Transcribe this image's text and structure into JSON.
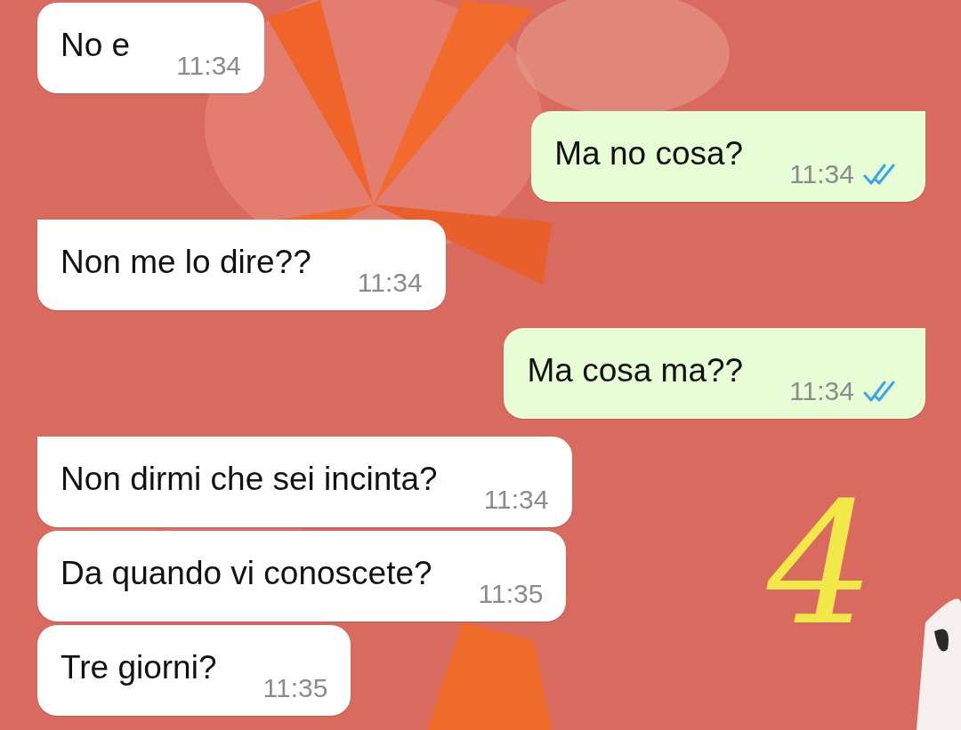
{
  "messages": [
    {
      "kind": "incoming",
      "text": "No e",
      "time": "11:34",
      "tail": false
    },
    {
      "kind": "outgoing",
      "text": "Ma no cosa?",
      "time": "11:34",
      "tail": true,
      "read": true
    },
    {
      "kind": "incoming",
      "text": "Non me lo dire??",
      "time": "11:34",
      "tail": true
    },
    {
      "kind": "outgoing",
      "text": "Ma cosa ma??",
      "time": "11:34",
      "tail": true,
      "read": true
    },
    {
      "kind": "incoming",
      "text": "Non dirmi che sei incinta?",
      "time": "11:34",
      "tail": true
    },
    {
      "kind": "incoming",
      "text": "Da quando vi conoscete?",
      "time": "11:35",
      "tail": false
    },
    {
      "kind": "incoming",
      "text": "Tre giorni?",
      "time": "11:35",
      "tail": false
    }
  ],
  "annotation": "4"
}
